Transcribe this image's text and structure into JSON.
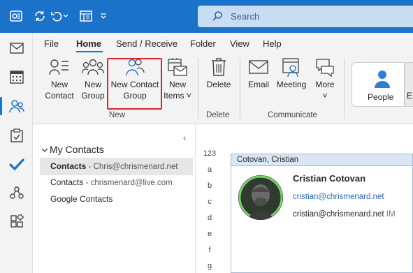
{
  "titlebar": {
    "search_placeholder": "Search",
    "icons": [
      "outlook-logo-icon",
      "sync-icon",
      "undo-icon",
      "layout-icon",
      "customize-dropdown-icon"
    ]
  },
  "rail": {
    "items": [
      {
        "name": "mail-icon"
      },
      {
        "name": "calendar-icon"
      },
      {
        "name": "people-icon",
        "active": true
      },
      {
        "name": "tasks-icon"
      },
      {
        "name": "todo-icon"
      },
      {
        "name": "groups-icon"
      },
      {
        "name": "apps-icon"
      }
    ]
  },
  "menu": {
    "tabs": [
      "File",
      "Home",
      "Send / Receive",
      "Folder",
      "View",
      "Help"
    ],
    "active_tab": "Home"
  },
  "ribbon": {
    "new_contact": [
      "New",
      "Contact"
    ],
    "new_group": [
      "New",
      "Group"
    ],
    "new_contact_group": [
      "New Contact",
      "Group"
    ],
    "new_items": [
      "New",
      "Items ˅"
    ],
    "new_group_label": "New",
    "delete": "Delete",
    "delete_group_label": "Delete",
    "email": "Email",
    "meeting": "Meeting",
    "more": "More",
    "more_chevron": "˅",
    "communicate_group_label": "Communicate",
    "people": "People",
    "people_next": "E"
  },
  "folders": {
    "collapse": "‹",
    "heading": "My Contacts",
    "items": [
      {
        "name": "Contacts",
        "account": "Chris@chrismenard.net",
        "selected": true
      },
      {
        "name": "Contacts",
        "account": "chrismenard@live.com",
        "selected": false
      },
      {
        "name": "Google Contacts",
        "account": "",
        "selected": false
      }
    ]
  },
  "index": [
    "123",
    "a",
    "b",
    "c",
    "d",
    "e",
    "f",
    "g"
  ],
  "card": {
    "header": "Cotovan, Cristian",
    "name": "Cristian Cotovan",
    "email": "cristian@chrismenard.net",
    "im": "cristian@chrismenard.net",
    "im_tag": "IM"
  },
  "colors": {
    "accent": "#1a73c8",
    "highlight_border": "#d9262b",
    "card_header": "#dae6f3"
  }
}
